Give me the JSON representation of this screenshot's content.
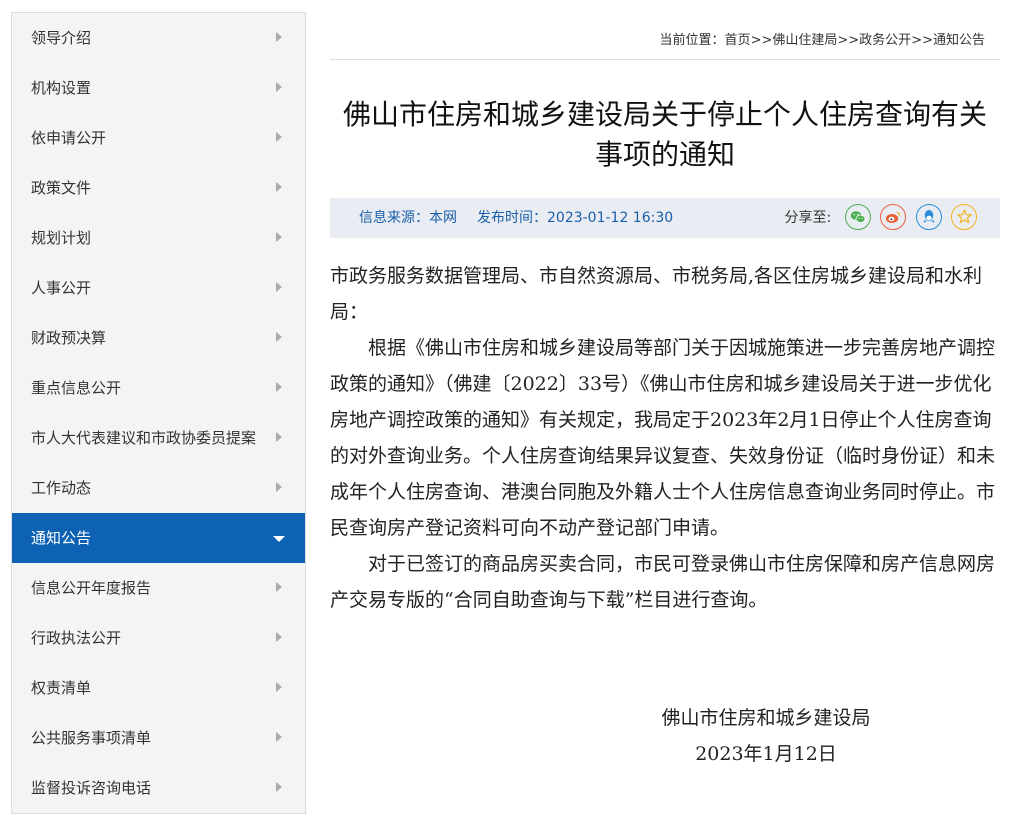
{
  "sidebar": {
    "items": [
      {
        "label": "领导介绍"
      },
      {
        "label": "机构设置"
      },
      {
        "label": "依申请公开"
      },
      {
        "label": "政策文件"
      },
      {
        "label": "规划计划"
      },
      {
        "label": "人事公开"
      },
      {
        "label": "财政预决算"
      },
      {
        "label": "重点信息公开"
      },
      {
        "label": "市人大代表建议和市政协委员提案"
      },
      {
        "label": "工作动态"
      },
      {
        "label": "通知公告",
        "active": true
      },
      {
        "label": "信息公开年度报告"
      },
      {
        "label": "行政执法公开"
      },
      {
        "label": "权责清单"
      },
      {
        "label": "公共服务事项清单"
      },
      {
        "label": "监督投诉咨询电话"
      }
    ]
  },
  "breadcrumb": {
    "prefix": "当前位置：",
    "items": [
      "首页",
      "佛山住建局",
      "政务公开",
      "通知公告"
    ],
    "separator": ">>"
  },
  "article": {
    "title": "佛山市住房和城乡建设局关于停止个人住房查询有关事项的通知",
    "source": "信息来源：本网",
    "publish_time": "发布时间：2023-01-12 16:30",
    "share_label": "分享至:",
    "share_icons": [
      "wechat-icon",
      "weibo-icon",
      "qq-icon",
      "qzone-icon"
    ],
    "paragraphs": [
      "市政务服务数据管理局、市自然资源局、市税务局,各区住房城乡建设局和水利局：",
      "根据《佛山市住房和城乡建设局等部门关于因城施策进一步完善房地产调控政策的通知》（佛建〔2022〕33号）《佛山市住房和城乡建设局关于进一步优化房地产调控政策的通知》有关规定，我局定于2023年2月1日停止个人住房查询的对外查询业务。个人住房查询结果异议复查、失效身份证（临时身份证）和未成年个人住房查询、港澳台同胞及外籍人士个人住房信息查询业务同时停止。市民查询房产登记资料可向不动产登记部门申请。",
      "对于已签订的商品房买卖合同，市民可登录佛山市住房保障和房产信息网房产交易专版的“合同自助查询与下载”栏目进行查询。"
    ],
    "signature_org": "佛山市住房和城乡建设局",
    "signature_date": "2023年1月12日"
  },
  "colors": {
    "active_nav": "#0e62b3",
    "meta_bar_bg": "#e9edf3",
    "meta_text": "#1a5fa8"
  }
}
